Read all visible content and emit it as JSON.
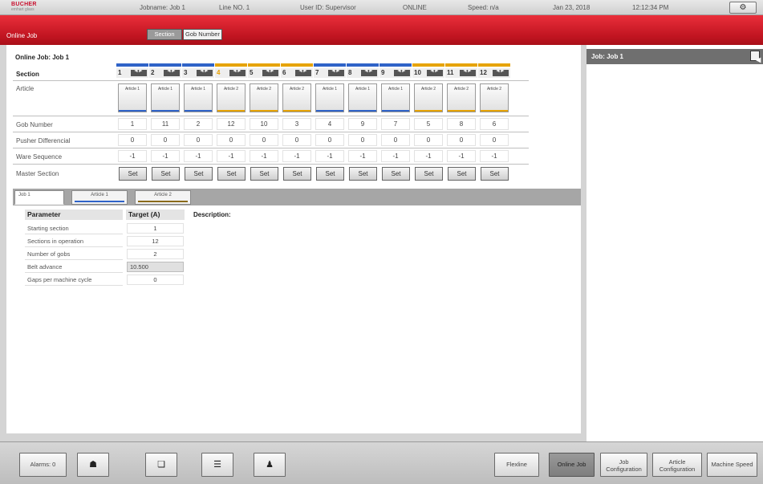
{
  "topbar": {
    "logo_line1": "BUCHER",
    "logo_line2": "emhart glass",
    "jobname": "Jobname: Job 1",
    "line_no": "Line NO. 1",
    "user_id": "User ID: Supervisor",
    "status": "ONLINE",
    "speed": "Speed: n/a",
    "date": "Jan 23, 2018",
    "time": "12:12:34 PM",
    "system_icon": "settings-gear-icon"
  },
  "header": {
    "page_title": "Online Job",
    "toggle_section": "Section",
    "toggle_gob": "Gob Number"
  },
  "main": {
    "job_title": "Online Job: Job 1",
    "row_labels": {
      "section": "Section",
      "article": "Article",
      "gob_number": "Gob Number",
      "pusher": "Pusher Differencial",
      "ware": "Ware Sequence",
      "master": "Master Section"
    },
    "colors": {
      "article1": "#2f63c8",
      "article2": "#e6a300"
    },
    "sections": [
      {
        "num": "1",
        "article": "Article 1",
        "art": 1,
        "gob": "1",
        "pusher": "0",
        "ware": "-1",
        "set": "Set"
      },
      {
        "num": "2",
        "article": "Article 1",
        "art": 1,
        "gob": "11",
        "pusher": "0",
        "ware": "-1",
        "set": "Set"
      },
      {
        "num": "3",
        "article": "Article 1",
        "art": 1,
        "gob": "2",
        "pusher": "0",
        "ware": "-1",
        "set": "Set"
      },
      {
        "num": "4",
        "article": "Article 2",
        "art": 2,
        "gob": "12",
        "pusher": "0",
        "ware": "-1",
        "set": "Set"
      },
      {
        "num": "5",
        "article": "Article 2",
        "art": 2,
        "gob": "10",
        "pusher": "0",
        "ware": "-1",
        "set": "Set"
      },
      {
        "num": "6",
        "article": "Article 2",
        "art": 2,
        "gob": "3",
        "pusher": "0",
        "ware": "-1",
        "set": "Set"
      },
      {
        "num": "7",
        "article": "Article 1",
        "art": 1,
        "gob": "4",
        "pusher": "0",
        "ware": "-1",
        "set": "Set"
      },
      {
        "num": "8",
        "article": "Article 1",
        "art": 1,
        "gob": "9",
        "pusher": "0",
        "ware": "-1",
        "set": "Set"
      },
      {
        "num": "9",
        "article": "Article 1",
        "art": 1,
        "gob": "7",
        "pusher": "0",
        "ware": "-1",
        "set": "Set"
      },
      {
        "num": "10",
        "article": "Article 2",
        "art": 2,
        "gob": "5",
        "pusher": "0",
        "ware": "-1",
        "set": "Set"
      },
      {
        "num": "11",
        "article": "Article 2",
        "art": 2,
        "gob": "8",
        "pusher": "0",
        "ware": "-1",
        "set": "Set"
      },
      {
        "num": "12",
        "article": "Article 2",
        "art": 2,
        "gob": "6",
        "pusher": "0",
        "ware": "-1",
        "set": "Set"
      }
    ],
    "tabs": {
      "job": "Job 1",
      "article1": "Article 1",
      "article2": "Article 2"
    },
    "params": {
      "header_param": "Parameter",
      "header_target": "Target (A)",
      "rows": [
        {
          "label": "Starting section",
          "value": "1"
        },
        {
          "label": "Sections in operation",
          "value": "12"
        },
        {
          "label": "Number of gobs",
          "value": "2"
        },
        {
          "label": "Belt advance",
          "value": "10.500"
        },
        {
          "label": "Gaps per machine cycle",
          "value": "0"
        }
      ]
    },
    "description_label": "Description:"
  },
  "right_panel": {
    "title": "Job: Job 1"
  },
  "bottombar": {
    "alarms": "Alarms: 0",
    "icon1": "home-icon",
    "icon2": "machine-icon",
    "icon3": "list-icon",
    "icon4": "operator-icon",
    "flexline": "Flexline",
    "online_job": "Online Job",
    "job_config_l1": "Job",
    "job_config_l2": "Configuration",
    "article_config_l1": "Article",
    "article_config_l2": "Configuration",
    "machine_speed": "Machine Speed"
  }
}
